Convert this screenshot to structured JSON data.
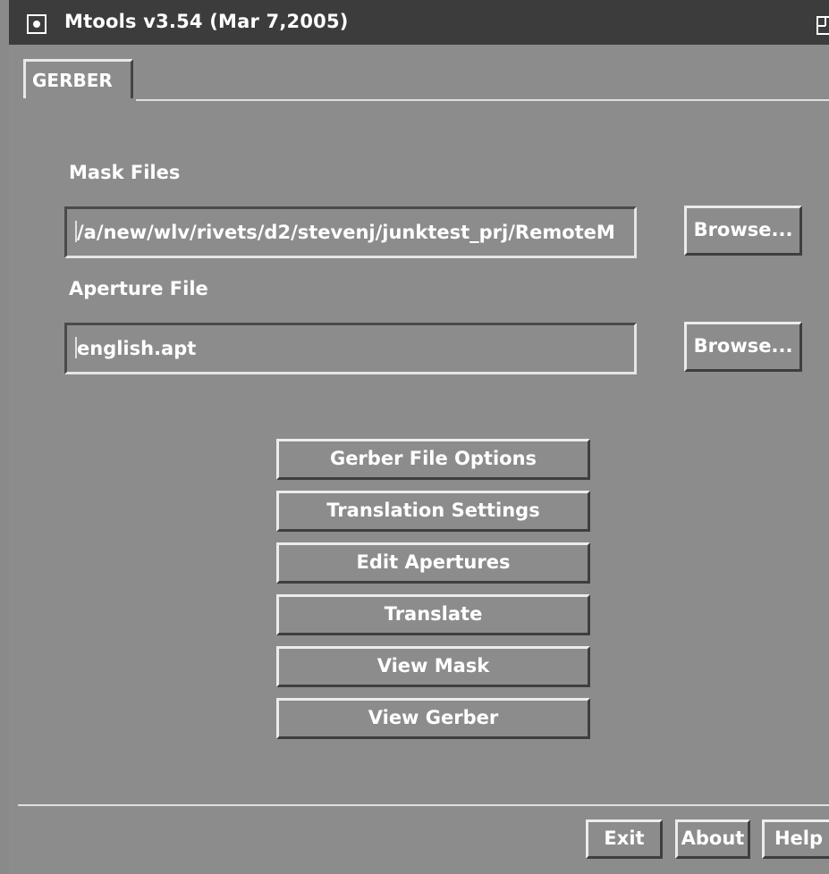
{
  "window": {
    "title": "Mtools v3.54 (Mar 7,2005)"
  },
  "tabs": [
    {
      "label": "GERBER"
    }
  ],
  "mask_files": {
    "label": "Mask Files",
    "value": "/a/new/wlv/rivets/d2/stevenj/junktest_prj/RemoteM",
    "browse_label": "Browse..."
  },
  "aperture_file": {
    "label": "Aperture File",
    "value": "english.apt",
    "browse_label": "Browse..."
  },
  "actions": {
    "gerber_file_options": "Gerber File Options",
    "translation_settings": "Translation Settings",
    "edit_apertures": "Edit Apertures",
    "translate": "Translate",
    "view_mask": "View Mask",
    "view_gerber": "View Gerber"
  },
  "footer": {
    "exit": "Exit",
    "about": "About",
    "help": "Help"
  }
}
